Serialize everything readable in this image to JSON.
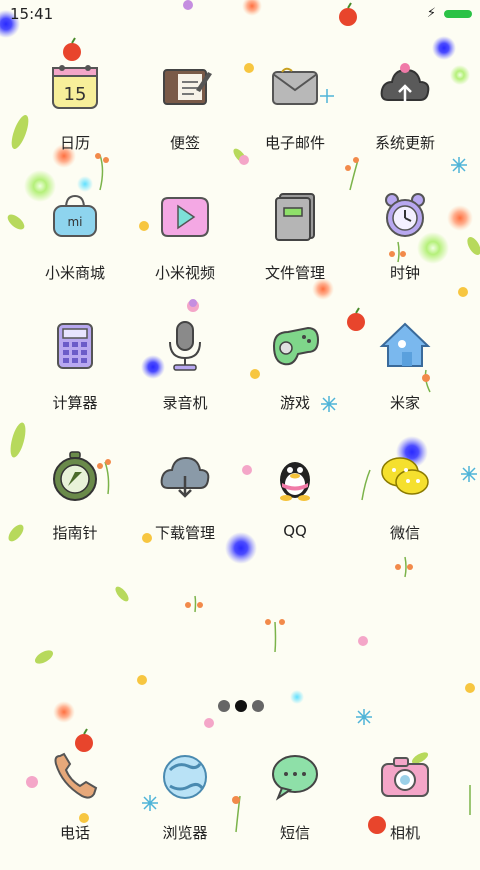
{
  "status_bar": {
    "time": "15:41"
  },
  "apps": [
    {
      "label": "日历",
      "icon": "calendar-icon",
      "calendar_date": "15"
    },
    {
      "label": "便签",
      "icon": "notes-icon"
    },
    {
      "label": "电子邮件",
      "icon": "email-icon"
    },
    {
      "label": "系统更新",
      "icon": "system-update-icon"
    },
    {
      "label": "小米商城",
      "icon": "mi-store-icon"
    },
    {
      "label": "小米视频",
      "icon": "video-icon"
    },
    {
      "label": "文件管理",
      "icon": "file-manager-icon"
    },
    {
      "label": "时钟",
      "icon": "clock-icon"
    },
    {
      "label": "计算器",
      "icon": "calculator-icon"
    },
    {
      "label": "录音机",
      "icon": "recorder-icon"
    },
    {
      "label": "游戏",
      "icon": "game-icon"
    },
    {
      "label": "米家",
      "icon": "mijia-icon"
    },
    {
      "label": "指南针",
      "icon": "compass-icon"
    },
    {
      "label": "下载管理",
      "icon": "download-icon"
    },
    {
      "label": "QQ",
      "icon": "qq-icon"
    },
    {
      "label": "微信",
      "icon": "wechat-icon"
    }
  ],
  "page_indicator": {
    "pages": 3,
    "current": 2
  },
  "dock": [
    {
      "label": "电话",
      "icon": "phone-icon"
    },
    {
      "label": "浏览器",
      "icon": "browser-icon"
    },
    {
      "label": "短信",
      "icon": "messages-icon"
    },
    {
      "label": "相机",
      "icon": "camera-icon"
    }
  ]
}
